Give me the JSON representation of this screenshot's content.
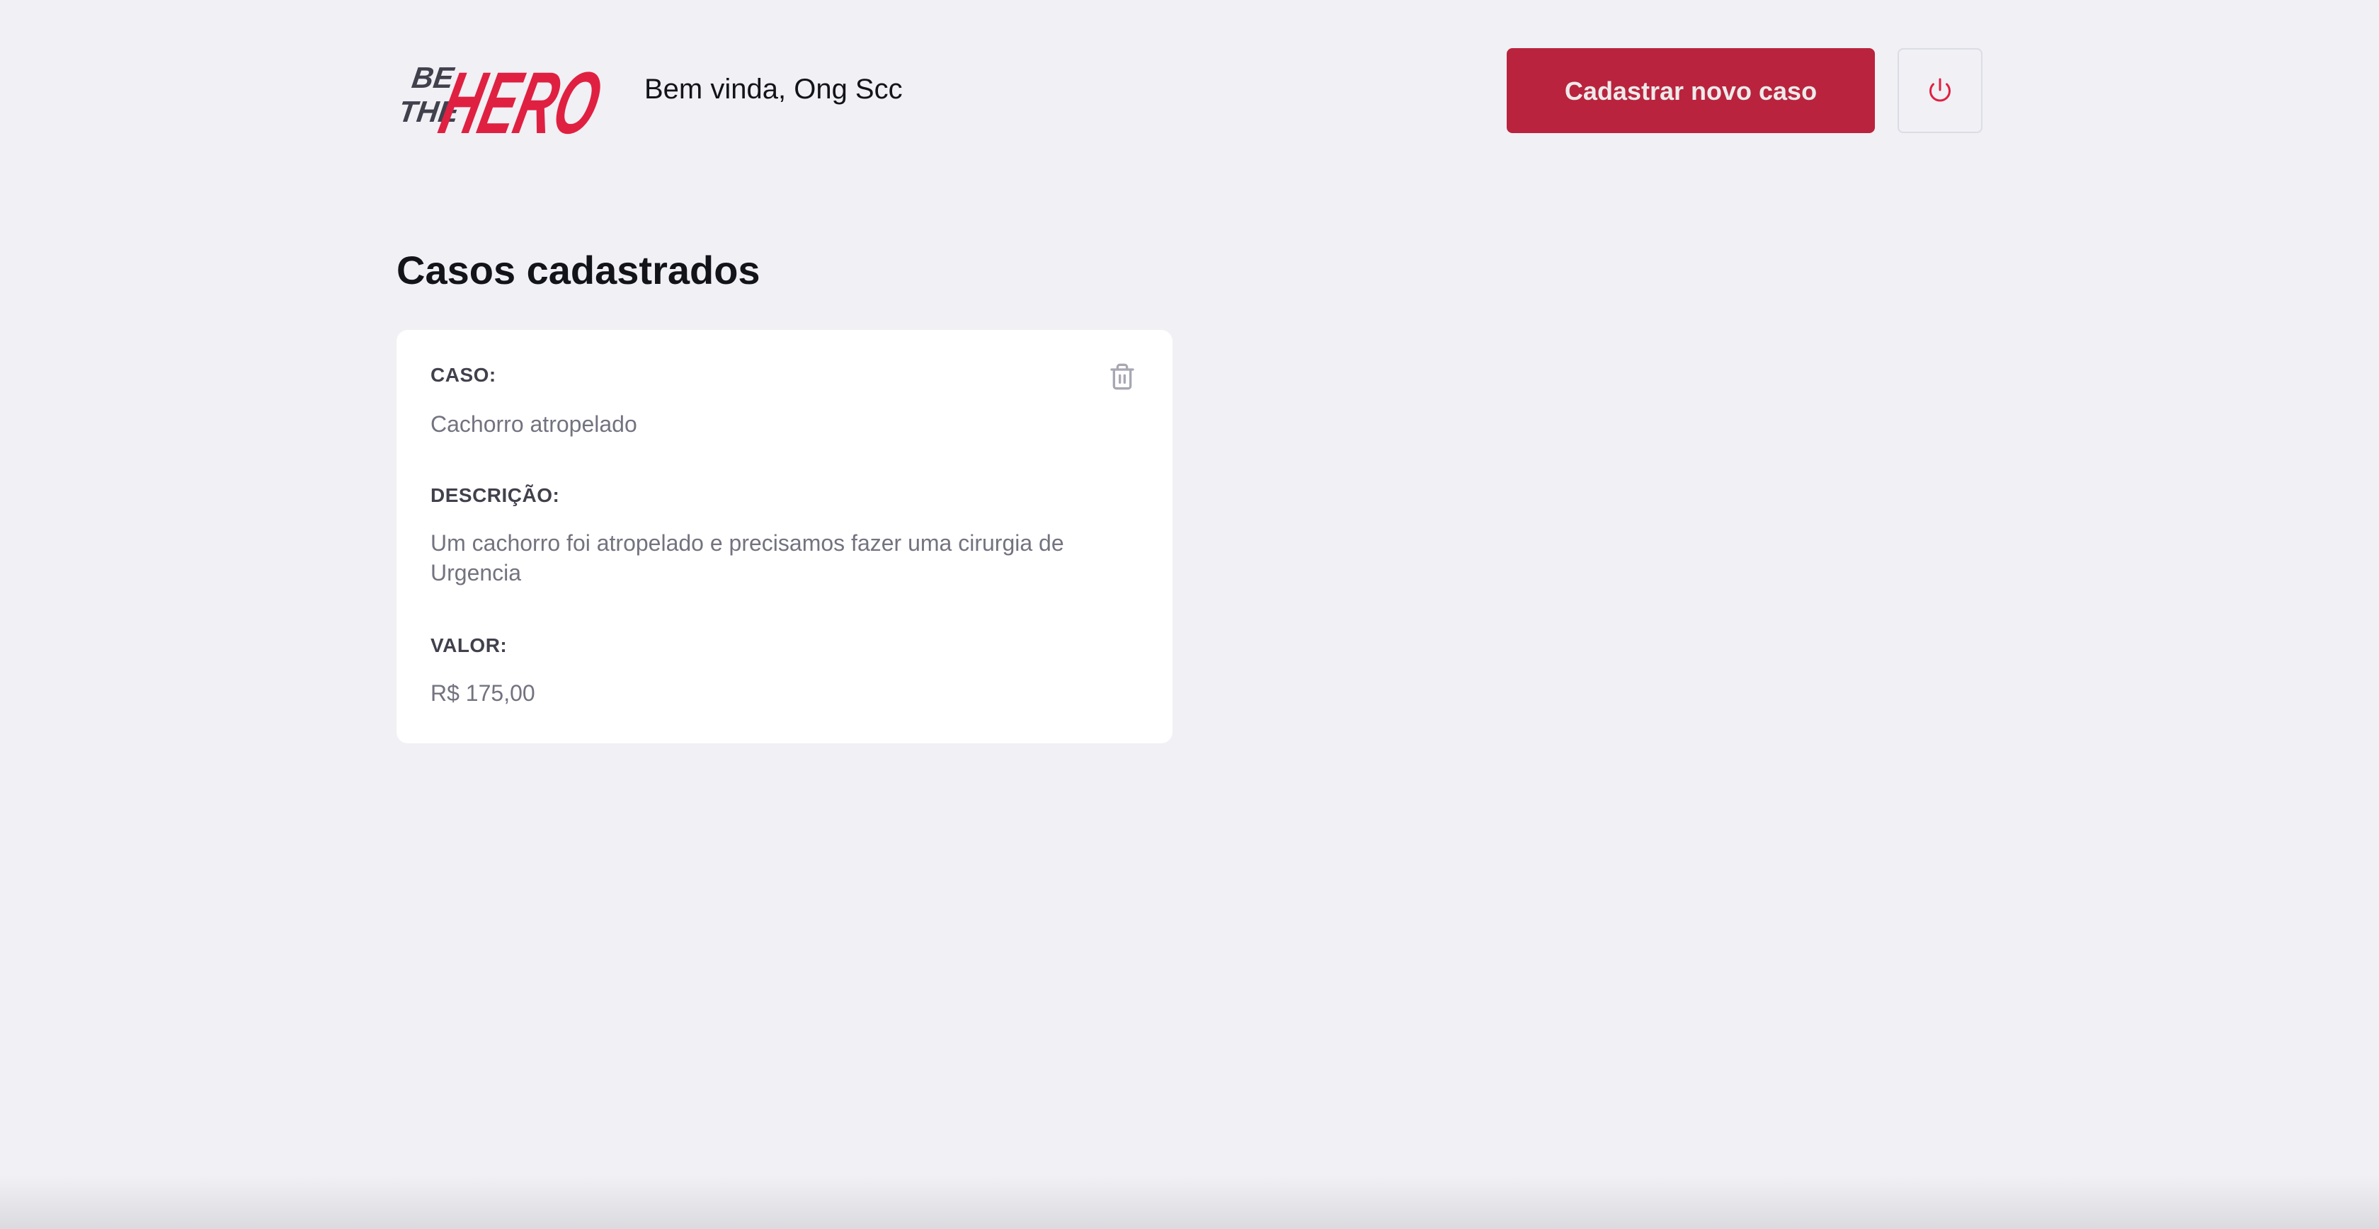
{
  "brand": {
    "logo_text_top": "BE",
    "logo_text_middle": "THE",
    "logo_text_main": "HERO",
    "accent_color": "#e02041",
    "dark_color": "#41414d"
  },
  "header": {
    "welcome": "Bem vinda, Ong Scc",
    "new_case_label": "Cadastrar novo caso",
    "logout_icon": "power-icon"
  },
  "main": {
    "title": "Casos cadastrados",
    "cases": [
      {
        "case_label": "CASO:",
        "case_value": "Cachorro atropelado",
        "description_label": "DESCRIÇÃO:",
        "description_value": "Um cachorro foi atropelado e precisamos fazer uma cirurgia de Urgencia",
        "value_label": "VALOR:",
        "value_value": "R$ 175,00",
        "delete_icon": "trash-icon"
      }
    ]
  }
}
